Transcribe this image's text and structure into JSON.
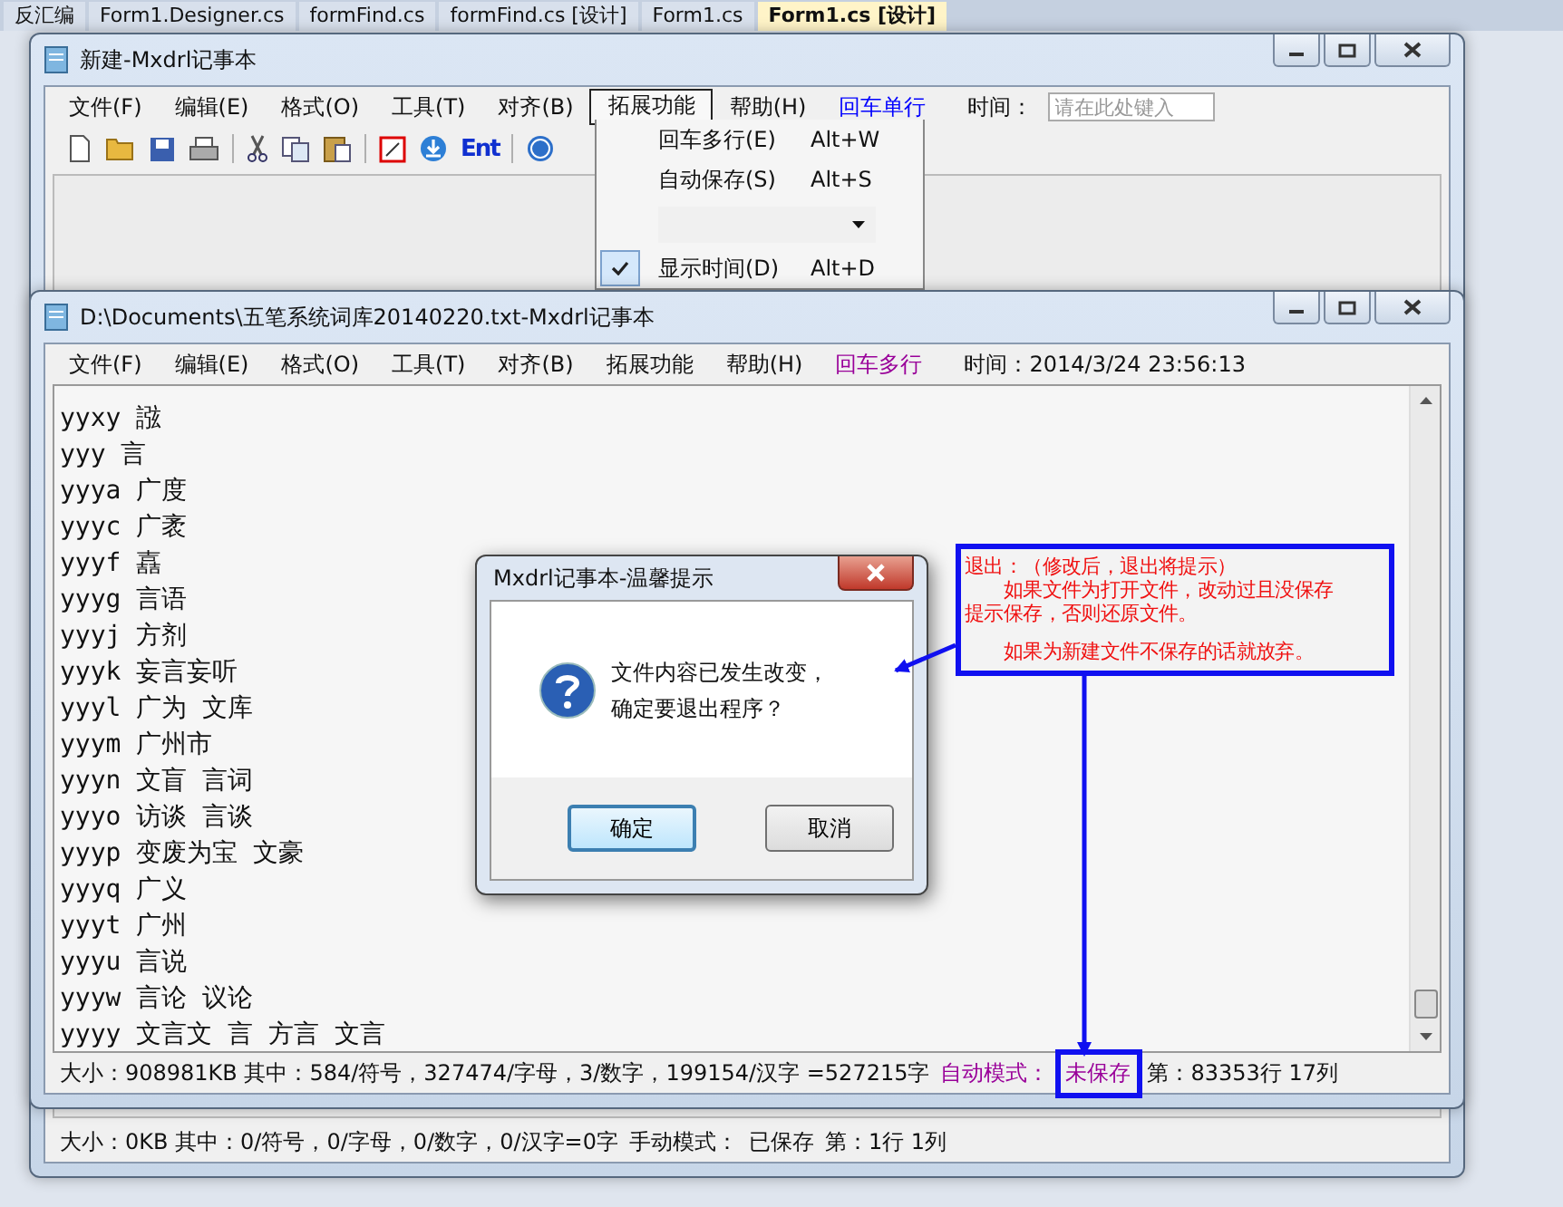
{
  "ide_tabs": [
    {
      "label": "反汇编",
      "selected": false
    },
    {
      "label": "Form1.Designer.cs",
      "selected": false
    },
    {
      "label": "formFind.cs",
      "selected": false
    },
    {
      "label": "formFind.cs [设计]",
      "selected": false
    },
    {
      "label": "Form1.cs",
      "selected": false
    },
    {
      "label": "Form1.cs [设计]",
      "selected": true
    }
  ],
  "back_window": {
    "title": "新建-Mxdrl记事本",
    "menu": [
      {
        "label": "文件(F)",
        "kind": "menu",
        "selected": false
      },
      {
        "label": "编辑(E)",
        "kind": "menu",
        "selected": false
      },
      {
        "label": "格式(O)",
        "kind": "menu",
        "selected": false
      },
      {
        "label": "工具(T)",
        "kind": "menu",
        "selected": false
      },
      {
        "label": "对齐(B)",
        "kind": "menu",
        "selected": false
      },
      {
        "label": "拓展功能",
        "kind": "menu",
        "selected": true
      },
      {
        "label": "帮助(H)",
        "kind": "menu",
        "selected": false
      },
      {
        "label": "回车单行",
        "kind": "toggle",
        "color": "#0000ff",
        "selected": false
      }
    ],
    "time_label": "时间：",
    "time_placeholder": "请在此处键入",
    "toolbar_text": "Ent",
    "status": {
      "summary": "大小：0KB  其中：0/符号，0/字母，0/数字，0/汉字=0字",
      "mode_label": "手动模式：",
      "mode_value": "已保存",
      "position": "第：1行 1列",
      "auto": false
    }
  },
  "dropdown": [
    {
      "kind": "command",
      "label": "回车多行(E)",
      "shortcut": "Alt+W",
      "checked": false
    },
    {
      "kind": "command",
      "label": "自动保存(S)",
      "shortcut": "Alt+S",
      "checked": false
    },
    {
      "kind": "combo"
    },
    {
      "kind": "command",
      "label": "显示时间(D)",
      "shortcut": "Alt+D",
      "checked": true
    }
  ],
  "front_window": {
    "title": "D:\\Documents\\五笔系统词库20140220.txt-Mxdrl记事本",
    "menu": [
      {
        "label": "文件(F)",
        "kind": "menu"
      },
      {
        "label": "编辑(E)",
        "kind": "menu"
      },
      {
        "label": "格式(O)",
        "kind": "menu"
      },
      {
        "label": "工具(T)",
        "kind": "menu"
      },
      {
        "label": "对齐(B)",
        "kind": "menu"
      },
      {
        "label": "拓展功能",
        "kind": "menu"
      },
      {
        "label": "帮助(H)",
        "kind": "menu"
      },
      {
        "label": "回车多行",
        "kind": "toggle",
        "color": "#990099"
      }
    ],
    "time": "时间：2014/3/24 23:56:13",
    "lines": [
      "yyxy 誸",
      "yyy 言",
      "yyya 广度",
      "yyyc 广袤",
      "yyyf 嚞",
      "yyyg 言语",
      "yyyj 方剂",
      "yyyk 妄言妄听",
      "yyyl 广为 文库",
      "yyym 广州市",
      "yyyn 文盲 言词",
      "yyyo 访谈 言谈",
      "yyyp 变废为宝 文豪",
      "yyyq 广义",
      "yyyt 广州",
      "yyyu 言说",
      "yyyw 言论 议论",
      "yyyy 文言文 言 方言 文言"
    ],
    "status": {
      "summary": "大小：908981KB  其中：584/符号，327474/字母，3/数字，199154/汉字 =527215字",
      "mode_label": "自动模式：",
      "mode_value": "未保存",
      "position": "第：83353行 17列",
      "auto": true
    }
  },
  "dialog": {
    "title": "Mxdrl记事本-温馨提示",
    "message_lines": [
      "文件内容已发生改变，",
      "确定要退出程序？"
    ],
    "buttons": [
      {
        "label": "确定",
        "selected": true
      },
      {
        "label": "取消",
        "selected": false
      }
    ]
  },
  "annotation": {
    "lines": [
      "退出：（修改后，退出将提示）",
      "　　如果文件为打开文件，改动过且没保存",
      "提示保存，否则还原文件。",
      "　　如果为新建文件不保存的话就放弃。"
    ]
  }
}
